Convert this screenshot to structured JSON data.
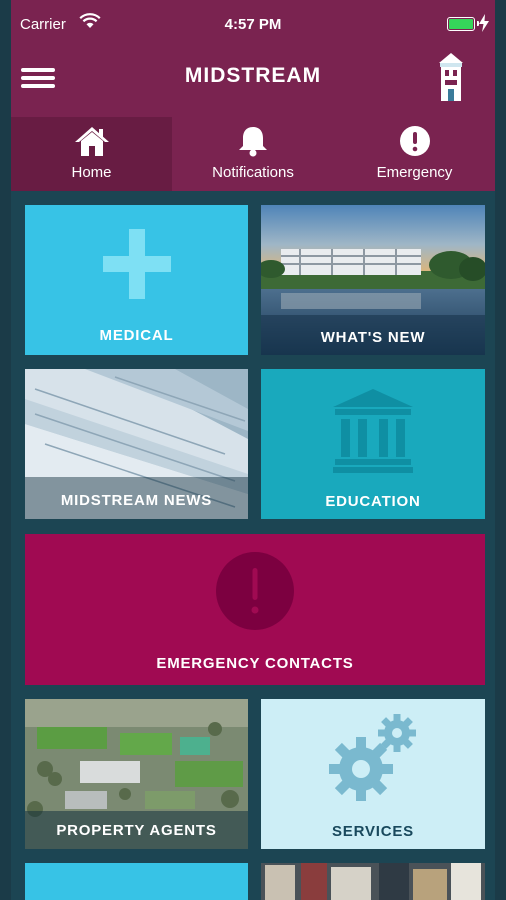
{
  "status_bar": {
    "carrier": "Carrier",
    "time": "4:57 PM"
  },
  "header": {
    "title": "MIDSTREAM"
  },
  "tabs": [
    {
      "label": "Home",
      "icon": "home-icon",
      "active": true
    },
    {
      "label": "Notifications",
      "icon": "bell-icon",
      "active": false
    },
    {
      "label": "Emergency",
      "icon": "exclamation-icon",
      "active": false
    }
  ],
  "tiles": [
    {
      "label": "MEDICAL",
      "icon": "plus-icon",
      "color": "#37c3e6"
    },
    {
      "label": "WHAT'S NEW",
      "icon": "photo"
    },
    {
      "label": "MIDSTREAM NEWS",
      "icon": "photo"
    },
    {
      "label": "EDUCATION",
      "icon": "building-icon",
      "color": "#19a9bd"
    },
    {
      "label": "EMERGENCY CONTACTS",
      "icon": "exclamation-icon",
      "color": "#a00a52"
    },
    {
      "label": "PROPERTY AGENTS",
      "icon": "photo"
    },
    {
      "label": "SERVICES",
      "icon": "gears-icon",
      "color": "#cdeef6"
    }
  ]
}
